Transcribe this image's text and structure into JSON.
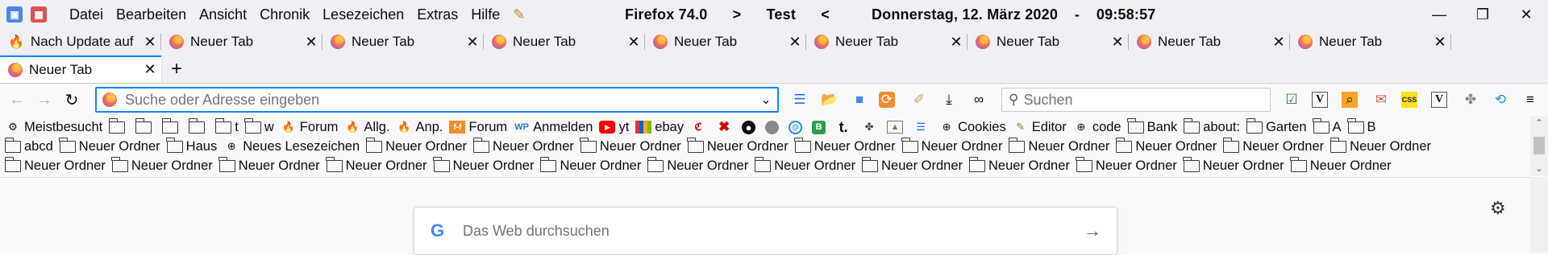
{
  "menubar": {
    "items": [
      "Datei",
      "Bearbeiten",
      "Ansicht",
      "Chronik",
      "Lesezeichen",
      "Extras",
      "Hilfe"
    ],
    "title": "Firefox 74.0      >      Test      <          Donnerstag, 12. März 2020    -    09:58:57"
  },
  "tabs_row1": [
    {
      "label": "Nach Update auf",
      "icon": "flame-icon"
    },
    {
      "label": "Neuer Tab",
      "icon": "firefox-icon"
    },
    {
      "label": "Neuer Tab",
      "icon": "firefox-icon"
    },
    {
      "label": "Neuer Tab",
      "icon": "firefox-icon"
    },
    {
      "label": "Neuer Tab",
      "icon": "firefox-icon"
    },
    {
      "label": "Neuer Tab",
      "icon": "firefox-icon"
    },
    {
      "label": "Neuer Tab",
      "icon": "firefox-icon"
    },
    {
      "label": "Neuer Tab",
      "icon": "firefox-icon"
    },
    {
      "label": "Neuer Tab",
      "icon": "firefox-icon"
    }
  ],
  "tabs_row2": {
    "active_tab": {
      "label": "Neuer Tab"
    },
    "new_tab_symbol": "+"
  },
  "urlbar": {
    "placeholder": "Suche oder Adresse eingeben"
  },
  "searchbar": {
    "placeholder": "Suchen"
  },
  "bookmarks": {
    "row1": {
      "meistbesucht": "Meistbesucht",
      "t": "t",
      "w": "w",
      "forum1": "Forum",
      "allg": "Allg.",
      "anp": "Anp.",
      "forum2": "Forum",
      "anmelden": "Anmelden",
      "yt": "yt",
      "ebay": "ebay",
      "cookies": "Cookies",
      "editor": "Editor",
      "code": "code",
      "bank": "Bank",
      "about": "about:",
      "garten": "Garten",
      "a": "A",
      "b": "B"
    },
    "row2": [
      "abcd",
      "Neuer Ordner",
      "Haus",
      "Neues Lesezeichen",
      "Neuer Ordner",
      "Neuer Ordner",
      "Neuer Ordner",
      "Neuer Ordner",
      "Neuer Ordner",
      "Neuer Ordner",
      "Neuer Ordner",
      "Neuer Ordner",
      "Neuer Ordner",
      "Neuer Ordner"
    ],
    "row3": [
      "Neuer Ordner",
      "Neuer Ordner",
      "Neuer Ordner",
      "Neuer Ordner",
      "Neuer Ordner",
      "Neuer Ordner",
      "Neuer Ordner",
      "Neuer Ordner",
      "Neuer Ordner",
      "Neuer Ordner",
      "Neuer Ordner",
      "Neuer Ordner",
      "Neuer Ordner"
    ]
  },
  "content": {
    "search_placeholder": "Das Web durchsuchen"
  },
  "colors": {
    "accent": "#0a84ff",
    "chrome": "#f0f0f4",
    "page": "#f9f9fb"
  }
}
